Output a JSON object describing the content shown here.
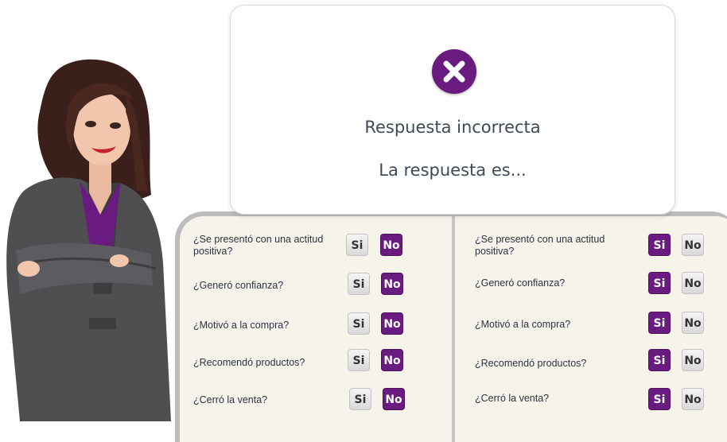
{
  "feedback": {
    "icon": "close-icon",
    "title": "Respuesta incorrecta",
    "subtitle": "La respuesta es..."
  },
  "colors": {
    "accent": "#6a1b80",
    "text": "#3e4a56"
  },
  "yes_label": "Si",
  "no_label": "No",
  "left_column": [
    {
      "question": "¿Se presentó con una actitud positiva?",
      "selected": "No"
    },
    {
      "question": "¿Generó confianza?",
      "selected": "No"
    },
    {
      "question": "¿Motivó a la compra?",
      "selected": "No"
    },
    {
      "question": "¿Recomendó productos?",
      "selected": "No"
    },
    {
      "question": "¿Cerró la venta?",
      "selected": "No"
    }
  ],
  "right_column": [
    {
      "question": "¿Se presentó con una actitud positiva?",
      "selected": "Si"
    },
    {
      "question": "¿Generó confianza?",
      "selected": "Si"
    },
    {
      "question": "¿Motivó a la compra?",
      "selected": "Si"
    },
    {
      "question": "¿Recomendó productos?",
      "selected": "Si"
    },
    {
      "question": "¿Cerró la venta?",
      "selected": "Si"
    }
  ]
}
